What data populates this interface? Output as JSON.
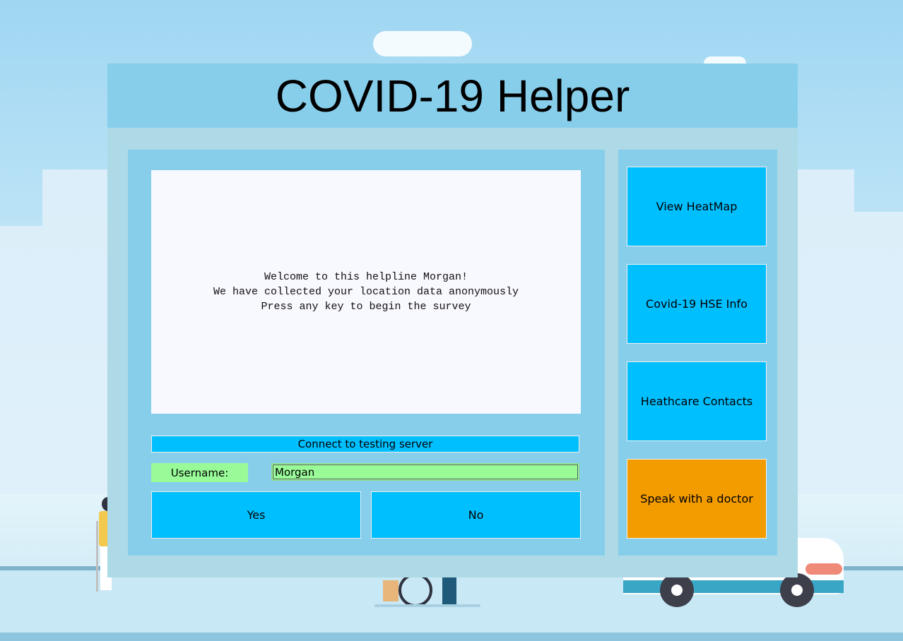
{
  "app": {
    "title": "COVID-19 Helper"
  },
  "message": {
    "text": "Welcome to this helpline Morgan!\nWe have collected your location data anonymously\nPress any key to begin the survey"
  },
  "connect": {
    "label": "Connect to testing server"
  },
  "username": {
    "label": "Username:",
    "value": "Morgan"
  },
  "answers": {
    "yes_label": "Yes",
    "no_label": "No"
  },
  "sidebar": {
    "items": [
      {
        "label": "View HeatMap"
      },
      {
        "label": "Covid-19 HSE Info"
      },
      {
        "label": "Heathcare Contacts"
      },
      {
        "label": "Speak with a doctor"
      }
    ]
  },
  "colors": {
    "title_bar": "#87ceeb",
    "window_bg": "#aed9e6",
    "button": "#00bfff",
    "doctor_button": "#f39c00",
    "username_field": "#98fb98",
    "message_bg": "#f8f8ff"
  }
}
